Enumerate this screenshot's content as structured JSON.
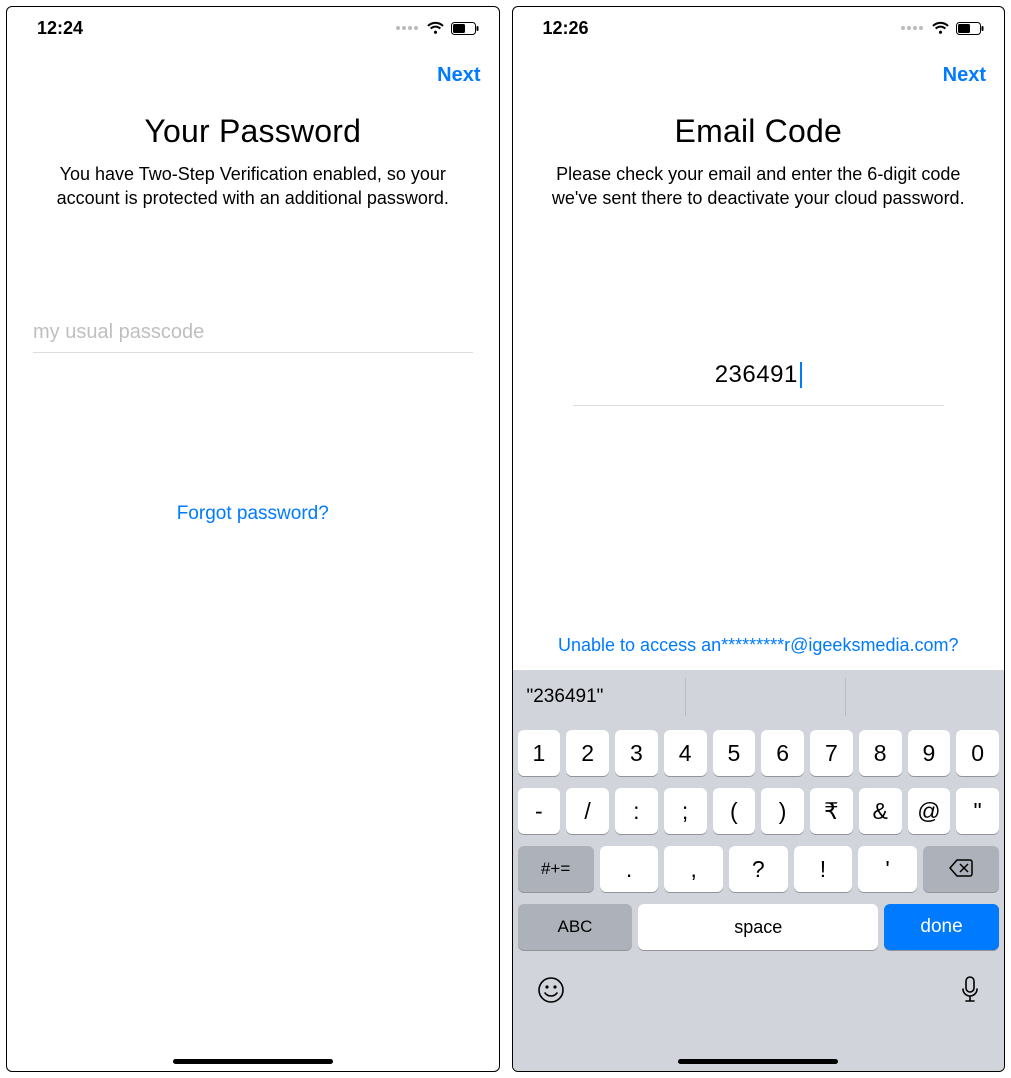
{
  "left": {
    "status_time": "12:24",
    "next_label": "Next",
    "title": "Your Password",
    "subtitle": "You have Two-Step Verification enabled, so your account is protected with an additional password.",
    "password_placeholder": "my usual passcode",
    "forgot_label": "Forgot password?"
  },
  "right": {
    "status_time": "12:26",
    "next_label": "Next",
    "title": "Email Code",
    "subtitle": "Please check your email and enter the 6-digit code we've sent there to deactivate your cloud password.",
    "code_value": "236491",
    "unable_label": "Unable to access an*********r@igeeksmedia.com?"
  },
  "keyboard": {
    "suggestion": "\"236491\"",
    "row1": [
      "1",
      "2",
      "3",
      "4",
      "5",
      "6",
      "7",
      "8",
      "9",
      "0"
    ],
    "row2": [
      "-",
      "/",
      ":",
      ";",
      "(",
      ")",
      "₹",
      "&",
      "@",
      "\""
    ],
    "shift_label": "#+=",
    "row3": [
      ".",
      ",",
      "?",
      "!",
      "'"
    ],
    "abc_label": "ABC",
    "space_label": "space",
    "done_label": "done"
  }
}
